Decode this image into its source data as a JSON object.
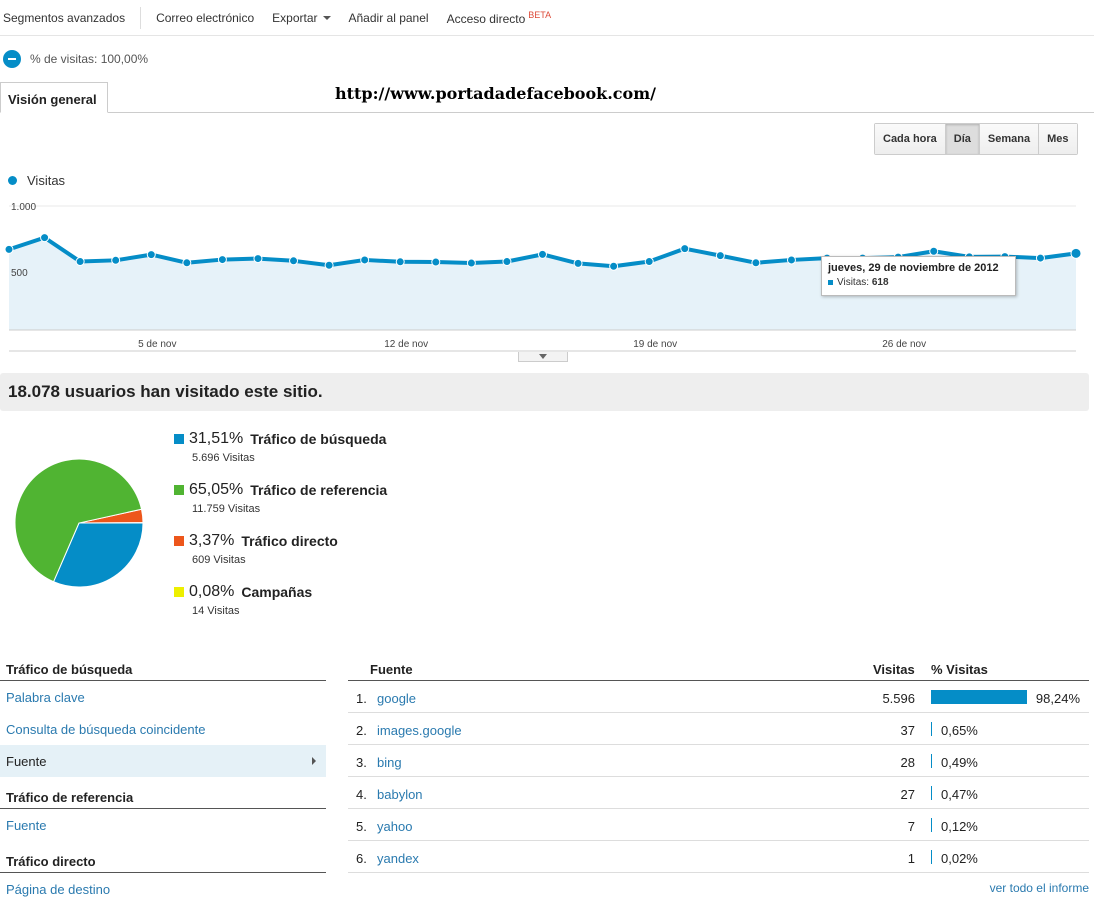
{
  "toolbar": {
    "segments": "Segmentos avanzados",
    "email": "Correo electrónico",
    "export": "Exportar",
    "add_panel": "Añadir al panel",
    "shortcut": "Acceso directo",
    "beta": "BETA"
  },
  "segment": {
    "label": "% de visitas: 100,00%"
  },
  "tabs": {
    "overview": "Visión general"
  },
  "watermark": "http://www.portadadefacebook.com/",
  "range_buttons": {
    "hour": "Cada hora",
    "day": "Día",
    "week": "Semana",
    "month": "Mes",
    "active": "day"
  },
  "chart_legend": "Visitas",
  "chart_data": {
    "type": "area",
    "series": [
      {
        "name": "Visitas",
        "values": [
          650,
          745,
          552,
          562,
          608,
          542,
          568,
          576,
          558,
          522,
          565,
          550,
          548,
          540,
          552,
          610,
          537,
          514,
          552,
          656,
          600,
          542,
          565,
          580,
          580,
          588,
          635,
          590,
          592,
          580,
          618
        ]
      }
    ],
    "x_ticks": [
      "5 de nov",
      "12 de nov",
      "19 de nov",
      "26 de nov"
    ],
    "y_ticks": [
      "1.000",
      "500"
    ],
    "ylim": [
      0,
      1000
    ],
    "tooltip_index": 30
  },
  "tooltip": {
    "date": "jueves, 29 de noviembre de 2012",
    "label": "Visitas:",
    "value": "618"
  },
  "banner": "18.078 usuarios han visitado este sitio.",
  "traffic": [
    {
      "pct": "31,51%",
      "name": "Tráfico de búsqueda",
      "visits": "5.696 Visitas",
      "value": 31.51,
      "color": "#058dc7"
    },
    {
      "pct": "65,05%",
      "name": "Tráfico de referencia",
      "visits": "11.759 Visitas",
      "value": 65.05,
      "color": "#50b432"
    },
    {
      "pct": "3,37%",
      "name": "Tráfico directo",
      "visits": "609 Visitas",
      "value": 3.37,
      "color": "#ed561b"
    },
    {
      "pct": "0,08%",
      "name": "Campañas",
      "visits": "14 Visitas",
      "value": 0.08,
      "color": "#edef00"
    }
  ],
  "nav": {
    "search_head": "Tráfico de búsqueda",
    "keyword": "Palabra clave",
    "matched_query": "Consulta de búsqueda coincidente",
    "source": "Fuente",
    "referral_head": "Tráfico de referencia",
    "referral_source": "Fuente",
    "direct_head": "Tráfico directo",
    "landing": "Página de destino"
  },
  "table": {
    "col_source": "Fuente",
    "col_visits": "Visitas",
    "col_pct": "% Visitas",
    "rows": [
      {
        "num": "1.",
        "source": "google",
        "visits": "5.596",
        "pct": "98,24%",
        "share": 0.9824
      },
      {
        "num": "2.",
        "source": "images.google",
        "visits": "37",
        "pct": "0,65%",
        "share": 0.0065
      },
      {
        "num": "3.",
        "source": "bing",
        "visits": "28",
        "pct": "0,49%",
        "share": 0.0049
      },
      {
        "num": "4.",
        "source": "babylon",
        "visits": "27",
        "pct": "0,47%",
        "share": 0.0047
      },
      {
        "num": "5.",
        "source": "yahoo",
        "visits": "7",
        "pct": "0,12%",
        "share": 0.0012
      },
      {
        "num": "6.",
        "source": "yandex",
        "visits": "1",
        "pct": "0,02%",
        "share": 0.0002
      }
    ],
    "view_all": "ver todo el informe"
  }
}
